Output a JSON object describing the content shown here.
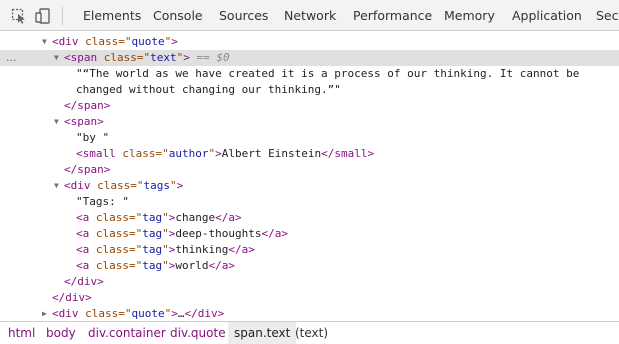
{
  "toolbar": {
    "inspect_icon": "inspect-cursor-icon",
    "device_icon": "device-toolbar-icon",
    "tabs": [
      "Elements",
      "Console",
      "Sources",
      "Network",
      "Performance",
      "Memory",
      "Application",
      "Secu"
    ],
    "active_tab": "Elements"
  },
  "tree": {
    "selected_line": 1,
    "lines": [
      {
        "arrow": "▼",
        "parts": [
          "<",
          "div",
          " ",
          "class",
          "=\"",
          "quote",
          "\"",
          ">"
        ]
      },
      {
        "arrow": "▼",
        "parts": [
          "<",
          "span",
          " ",
          "class",
          "=\"",
          "text",
          "\"",
          ">",
          " == $0"
        ]
      },
      {
        "text": "\"“The world as we have created it is a process of our thinking. It cannot be"
      },
      {
        "text": "changed without changing our thinking.”\""
      },
      {
        "parts": [
          "</",
          "span",
          ">"
        ]
      },
      {
        "arrow": "▼",
        "parts": [
          "<",
          "span",
          ">"
        ]
      },
      {
        "text": "\"by \""
      },
      {
        "parts": [
          "<",
          "small",
          " ",
          "class",
          "=\"",
          "author",
          "\"",
          ">",
          "Albert Einstein",
          "</",
          "small",
          ">"
        ]
      },
      {
        "parts": [
          "</",
          "span",
          ">"
        ]
      },
      {
        "arrow": "▼",
        "parts": [
          "<",
          "div",
          " ",
          "class",
          "=\"",
          "tags",
          "\"",
          ">"
        ]
      },
      {
        "text": "\"Tags: \""
      },
      {
        "parts": [
          "<",
          "a",
          " ",
          "class",
          "=\"",
          "tag",
          "\"",
          ">",
          "change",
          "</",
          "a",
          ">"
        ]
      },
      {
        "parts": [
          "<",
          "a",
          " ",
          "class",
          "=\"",
          "tag",
          "\"",
          ">",
          "deep-thoughts",
          "</",
          "a",
          ">"
        ]
      },
      {
        "parts": [
          "<",
          "a",
          " ",
          "class",
          "=\"",
          "tag",
          "\"",
          ">",
          "thinking",
          "</",
          "a",
          ">"
        ]
      },
      {
        "parts": [
          "<",
          "a",
          " ",
          "class",
          "=\"",
          "tag",
          "\"",
          ">",
          "world",
          "</",
          "a",
          ">"
        ]
      },
      {
        "parts": [
          "</",
          "div",
          ">"
        ]
      },
      {
        "parts": [
          "</",
          "div",
          ">"
        ]
      },
      {
        "arrow": "▶",
        "parts": [
          "<",
          "div",
          " ",
          "class",
          "=\"",
          "quote",
          "\"",
          ">",
          "…",
          "</",
          "div",
          ">"
        ]
      }
    ],
    "selected_marker": "..."
  },
  "breadcrumb": {
    "items": [
      "html",
      "body",
      "div.container",
      "div.quote",
      "span.text",
      "(text)"
    ]
  }
}
